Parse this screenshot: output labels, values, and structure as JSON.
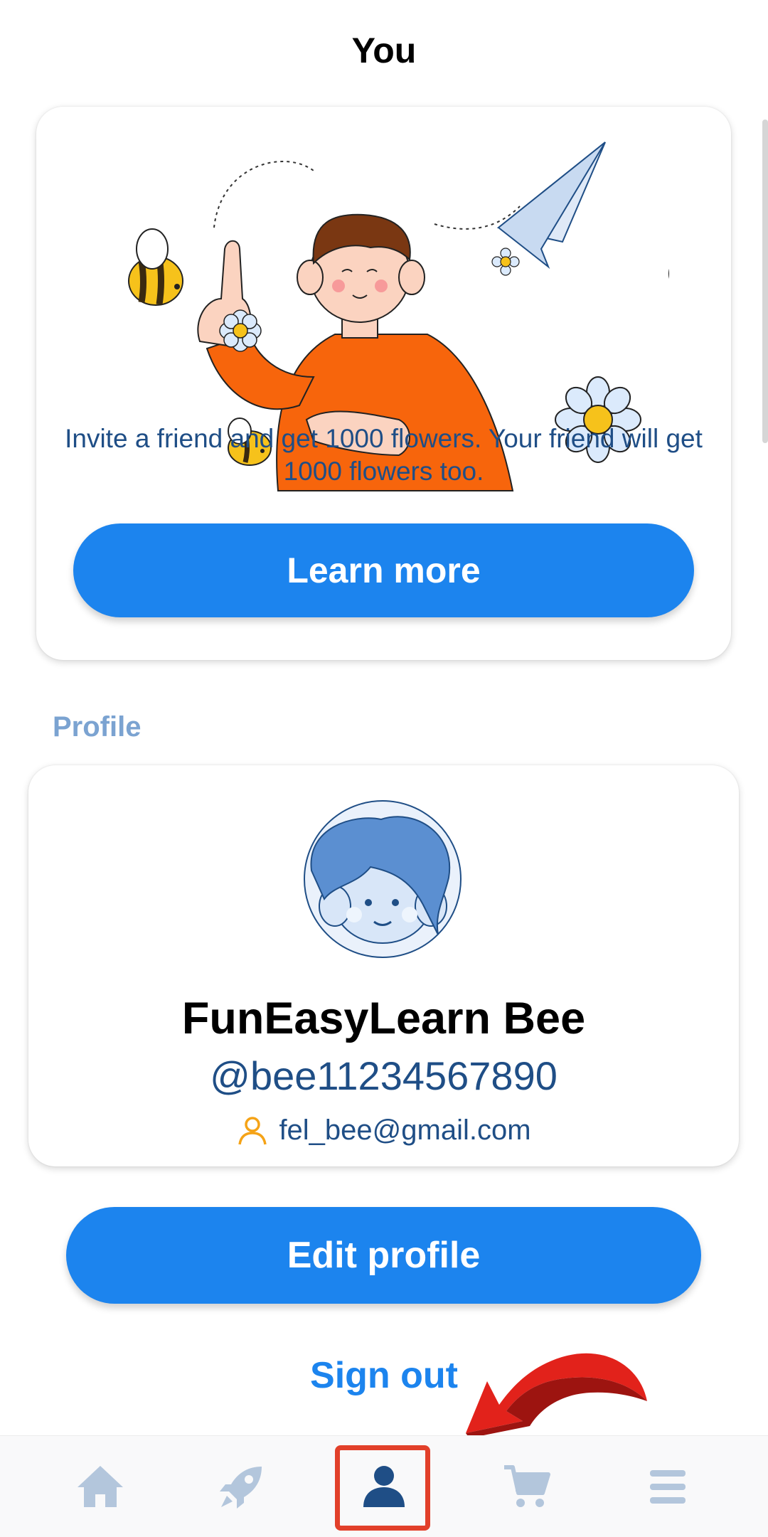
{
  "header": {
    "title": "You"
  },
  "invite": {
    "text": "Invite a friend and get 1000 flowers. Your friend will get 1000 flowers too.",
    "button_label": "Learn more",
    "illustration": "invite-friend-illustration"
  },
  "profile": {
    "section_label": "Profile",
    "avatar_icon": "avatar-icon",
    "name": "FunEasyLearn Bee",
    "handle": "@bee11234567890",
    "email_icon": "person-icon",
    "email": "fel_bee@gmail.com"
  },
  "actions": {
    "edit_profile_label": "Edit profile",
    "sign_out_label": "Sign out"
  },
  "bottom_nav": {
    "items": [
      {
        "icon": "home-icon",
        "active": false
      },
      {
        "icon": "rocket-icon",
        "active": false
      },
      {
        "icon": "profile-icon",
        "active": true
      },
      {
        "icon": "cart-icon",
        "active": false
      },
      {
        "icon": "menu-icon",
        "active": false
      }
    ]
  },
  "colors": {
    "accent": "#1c84ee",
    "text_dark_blue": "#1f4e86",
    "section_label": "#7ba3d1",
    "nav_inactive": "#b3c6dc",
    "nav_active": "#1f4e86",
    "annotation_red": "#e2402a"
  }
}
